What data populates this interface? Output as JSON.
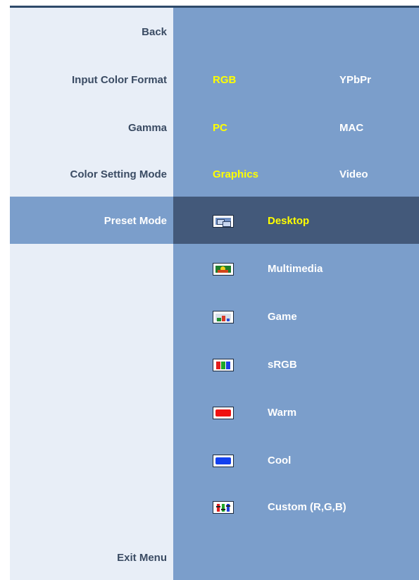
{
  "menu": {
    "back": "Back",
    "input_color_format": "Input Color Format",
    "gamma": "Gamma",
    "color_setting_mode": "Color Setting Mode",
    "preset_mode": "Preset Mode",
    "exit": "Exit Menu"
  },
  "options": {
    "input_color_format": [
      "RGB",
      "YPbPr"
    ],
    "gamma": [
      "PC",
      "MAC"
    ],
    "color_setting_mode": [
      "Graphics",
      "Video"
    ]
  },
  "selected": {
    "input_color_format": "RGB",
    "gamma": "PC",
    "color_setting_mode": "Graphics",
    "preset_mode": "Desktop"
  },
  "presets": [
    {
      "label": "Desktop",
      "icon": "desktop-icon"
    },
    {
      "label": "Multimedia",
      "icon": "multimedia-icon"
    },
    {
      "label": "Game",
      "icon": "game-icon"
    },
    {
      "label": "sRGB",
      "icon": "srgb-icon"
    },
    {
      "label": "Warm",
      "icon": "warm-icon"
    },
    {
      "label": "Cool",
      "icon": "cool-icon"
    },
    {
      "label": "Custom (R,G,B)",
      "icon": "custom-rgb-icon"
    }
  ],
  "colors": {
    "left_panel": "#e8eef7",
    "right_panel": "#7b9ecb",
    "highlight": "#43597a",
    "selected_text": "#ffff00",
    "label_text": "#3a4b63"
  }
}
